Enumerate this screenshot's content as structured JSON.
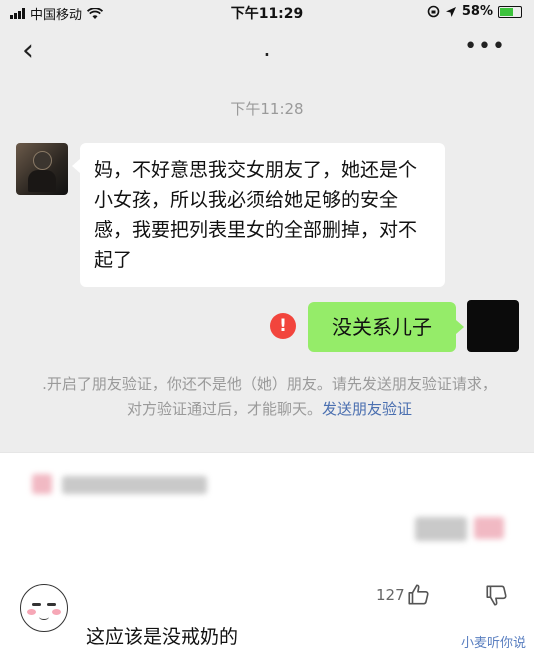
{
  "status_bar": {
    "carrier": "中国移动",
    "time": "下午11:29",
    "battery": "58%",
    "battery_level": 0.58,
    "wifi_icon": "wifi-icon",
    "location_icon": "location-arrow-icon",
    "lock_icon": "orientation-lock-icon"
  },
  "nav": {
    "back_icon": "chevron-left-icon",
    "title": ".",
    "more_icon": "more-dots-icon"
  },
  "chat": {
    "timestamp": "下午11:28",
    "incoming_message": "妈，不好意思我交女朋友了，她还是个小女孩，所以我必须给她足够的安全感，我要把列表里女的全部删掉，对不起了",
    "outgoing_message": "没关系儿子",
    "send_error_icon": "!",
    "system_note": ".开启了朋友验证，你还不是他（她）朋友。请先发送朋友验证请求，对方验证通过后，才能聊天。",
    "system_link": "发送朋友验证"
  },
  "comment": {
    "like_count": "127",
    "text": "这应该是没戒奶的",
    "like_icon": "thumb-up-icon",
    "dislike_icon": "thumb-down-icon"
  },
  "watermark": "小麦听你说",
  "colors": {
    "chat_bg": "#ededed",
    "outgoing_bubble": "#95ec69",
    "error_red": "#f2453d",
    "link_blue": "#4a6fb0"
  }
}
